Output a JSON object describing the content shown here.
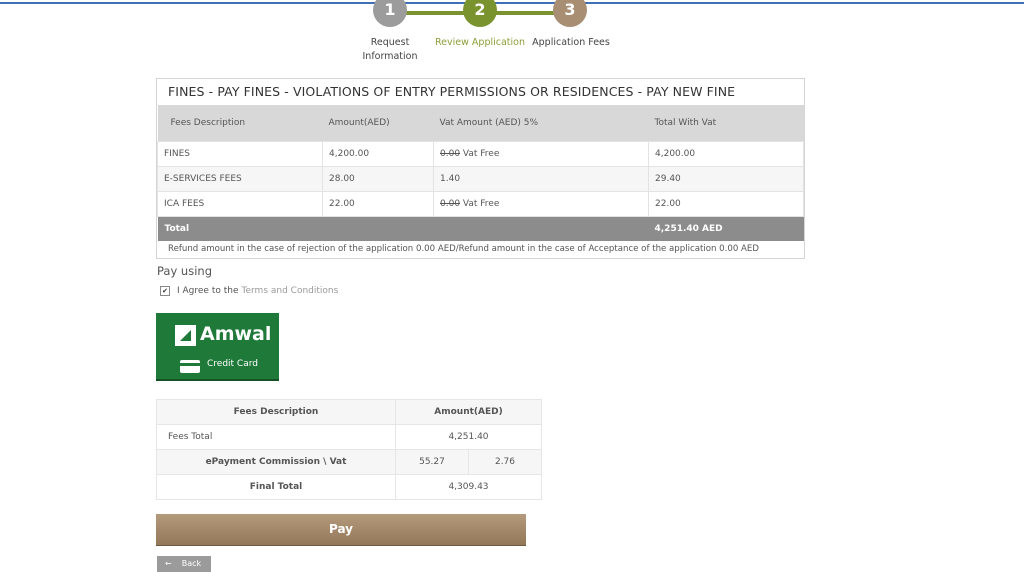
{
  "steps": [
    {
      "number": "1",
      "label": "Request Information"
    },
    {
      "number": "2",
      "label": "Review Application"
    },
    {
      "number": "3",
      "label": "Application Fees"
    }
  ],
  "fees": {
    "title": "FINES - PAY FINES - VIOLATIONS OF ENTRY PERMISSIONS OR RESIDENCES - PAY NEW FINE",
    "headers": [
      "Fees Description",
      "Amount(AED)",
      "Vat Amount (AED) 5%",
      "Total With Vat"
    ],
    "rows": [
      {
        "desc": "FINES",
        "amount": "4,200.00",
        "vat_struck": "0.00",
        "vat_note": " Vat Free",
        "total": "4,200.00"
      },
      {
        "desc": "E-SERVICES FEES",
        "amount": "28.00",
        "vat": "1.40",
        "total": "29.40"
      },
      {
        "desc": "ICA FEES",
        "amount": "22.00",
        "vat_struck": "0.00",
        "vat_note": " Vat Free",
        "total": "22.00"
      }
    ],
    "total_label": "Total",
    "total_value": "4,251.40 AED",
    "refund_note": "Refund amount in the case of rejection of the application 0.00 AED/Refund amount in the case of Acceptance of the application 0.00 AED"
  },
  "payment": {
    "pay_using": "Pay using",
    "agree_text": "I Agree to the",
    "terms_link": "Terms and Conditions",
    "agreed": true,
    "amwal_name": "Amwal",
    "credit_card_label": "Credit Card"
  },
  "summary": {
    "header_desc": "Fees Description",
    "header_amount": "Amount(AED)",
    "fees_total_label": "Fees Total",
    "fees_total_value": "4,251.40",
    "commission_label": "ePayment Commission \\ Vat",
    "commission_value": "55.27",
    "commission_vat": "2.76",
    "final_total_label": "Final Total",
    "final_total_value": "4,309.43"
  },
  "actions": {
    "pay_label": "Pay",
    "back_label": "Back"
  },
  "colors": {
    "active_step": "#7b932f",
    "pay_button": "#a58a6a",
    "amwal_green": "#1f7a3a"
  }
}
